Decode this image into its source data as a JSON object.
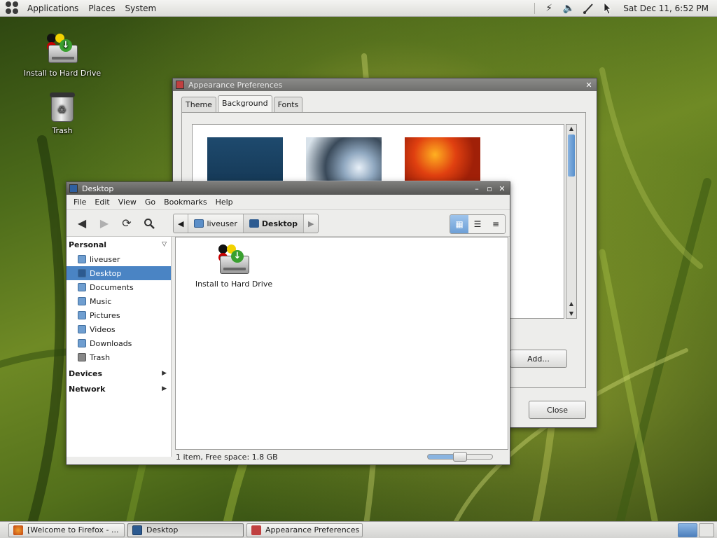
{
  "top_panel": {
    "menus": [
      "Applications",
      "Places",
      "System"
    ],
    "clock": "Sat Dec 11,  6:52 PM"
  },
  "desktop_icons": [
    {
      "label": "Install to Hard Drive",
      "icon": "drive-install-icon"
    },
    {
      "label": "Trash",
      "icon": "trash-icon"
    }
  ],
  "appearance": {
    "title": "Appearance Preferences",
    "tabs": [
      "Theme",
      "Background",
      "Fonts"
    ],
    "selected_tab": "Background",
    "add_label": "Add...",
    "close_label": "Close"
  },
  "filemanager": {
    "title": "Desktop",
    "menus": [
      "File",
      "Edit",
      "View",
      "Go",
      "Bookmarks",
      "Help"
    ],
    "path": [
      "liveuser",
      "Desktop"
    ],
    "sidebar": {
      "personal_label": "Personal",
      "items": [
        "liveuser",
        "Desktop",
        "Documents",
        "Music",
        "Pictures",
        "Videos",
        "Downloads",
        "Trash"
      ],
      "selected": "Desktop",
      "devices_label": "Devices",
      "network_label": "Network"
    },
    "files": [
      {
        "name": "Install to Hard Drive",
        "icon": "drive-install-icon"
      }
    ],
    "status": "1 item, Free space: 1.8 GB",
    "zoom_level": 0.5
  },
  "taskbar": {
    "tasks": [
      {
        "label": "[Welcome to Firefox - ...",
        "icon": "firefox-icon"
      },
      {
        "label": "Desktop",
        "icon": "folder-icon"
      },
      {
        "label": "Appearance Preferences",
        "icon": "appearance-icon"
      }
    ],
    "active_task": "Desktop"
  },
  "colors": {
    "selection": "#4a84c4",
    "accent": "#6d9fd6"
  }
}
